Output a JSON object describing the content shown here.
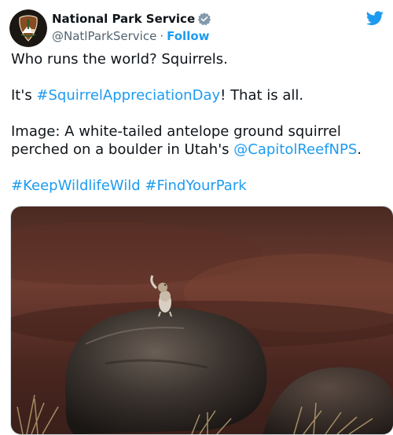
{
  "account": {
    "display_name": "National Park Service",
    "handle": "@NatlParkService",
    "separator": "·",
    "follow_label": "Follow",
    "verified_icon": "verified-badge-icon"
  },
  "brand": {
    "link_color": "#1d9bf0",
    "avatar_bg": "#2b2019",
    "avatar_badge_color": "#8a4a22",
    "bird_icon": "twitter-bird-icon"
  },
  "tweet": {
    "line1": "Who runs the world? Squirrels.",
    "line2_pre": "It's ",
    "line2_hashtag": "#SquirrelAppreciationDay",
    "line2_post": "! That is all.",
    "line3_pre": "Image: A white-tailed antelope ground squirrel perched on a boulder in Utah's ",
    "line3_mention": "@CapitolReefNPS",
    "line3_post": ".",
    "hashtag_a": "#KeepWildlifeWild",
    "hashtag_b": "#FindYourPark"
  },
  "media": {
    "subject": "white-tailed-antelope-ground-squirrel-on-boulder"
  }
}
